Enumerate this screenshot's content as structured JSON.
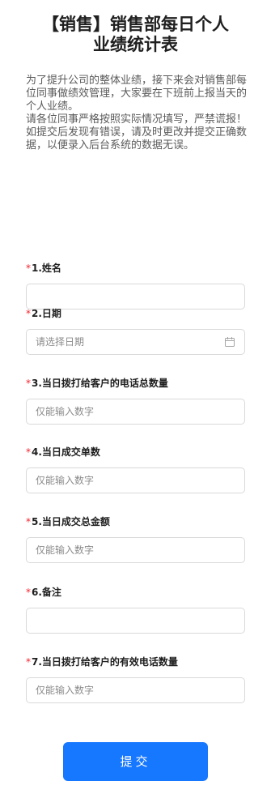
{
  "form": {
    "title": "【销售】销售部每日个人\n业绩统计表",
    "description": "为了提升公司的整体业绩，接下来会对销售部每位同事做绩效管理，大家要在下班前上报当天的个人业绩。\n请各位同事严格按照实际情况填写，严禁谎报！如提交后发现有错误，请及时更改并提交正确数据，以便录入后台系统的数据无误。",
    "required_mark": "*",
    "fields": [
      {
        "label": "1.姓名",
        "placeholder": "",
        "value": ""
      },
      {
        "label": "2.日期",
        "placeholder": "请选择日期",
        "value": "",
        "icon": "calendar-icon"
      },
      {
        "label": "3.当日拨打给客户的电话总数量",
        "placeholder": "仅能输入数字",
        "value": ""
      },
      {
        "label": "4.当日成交单数",
        "placeholder": "仅能输入数字",
        "value": ""
      },
      {
        "label": "5.当日成交总金额",
        "placeholder": "仅能输入数字",
        "value": ""
      },
      {
        "label": "6.备注",
        "placeholder": "",
        "value": ""
      },
      {
        "label": "7.当日拨打给客户的有效电话数量",
        "placeholder": "仅能输入数字",
        "value": ""
      }
    ],
    "submit_label": "提交"
  },
  "colors": {
    "accent": "#1677ff",
    "required": "#f5222d",
    "border": "#d9d9d9"
  }
}
